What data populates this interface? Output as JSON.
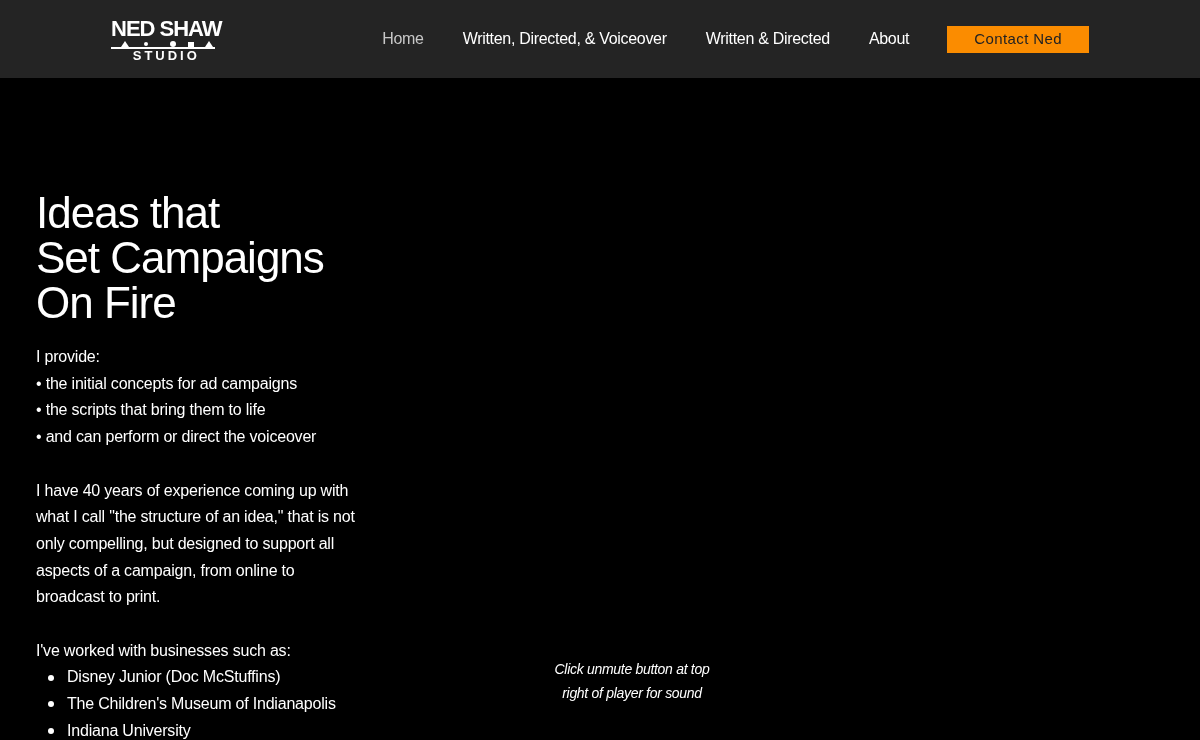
{
  "logo": {
    "name": "NED SHAW",
    "subtitle": "STUDIO"
  },
  "nav": [
    {
      "label": "Home",
      "selected": true
    },
    {
      "label": "Written, Directed, & Voiceover",
      "selected": false
    },
    {
      "label": "Written & Directed",
      "selected": false
    },
    {
      "label": "About",
      "selected": false
    }
  ],
  "contact_button": "Contact Ned",
  "headline": [
    "Ideas that",
    "Set Campaigns",
    "On Fire"
  ],
  "intro": "I provide:",
  "provides": [
    "• the initial concepts for ad campaigns",
    "• the scripts that bring them to life",
    "• and can perform or direct the voiceover"
  ],
  "experience": "I have 40 years of experience coming up with what I call \"the structure of an idea,\" that is not only compelling, but designed to support all aspects of a campaign, from online to broadcast to print.",
  "clients_intro": "I've worked with businesses such as:",
  "clients": [
    "Disney Junior (Doc McStuffins)",
    "The Children's Museum of Indianapolis",
    "Indiana University"
  ],
  "video_caption": "Click unmute button at top right of player for sound"
}
